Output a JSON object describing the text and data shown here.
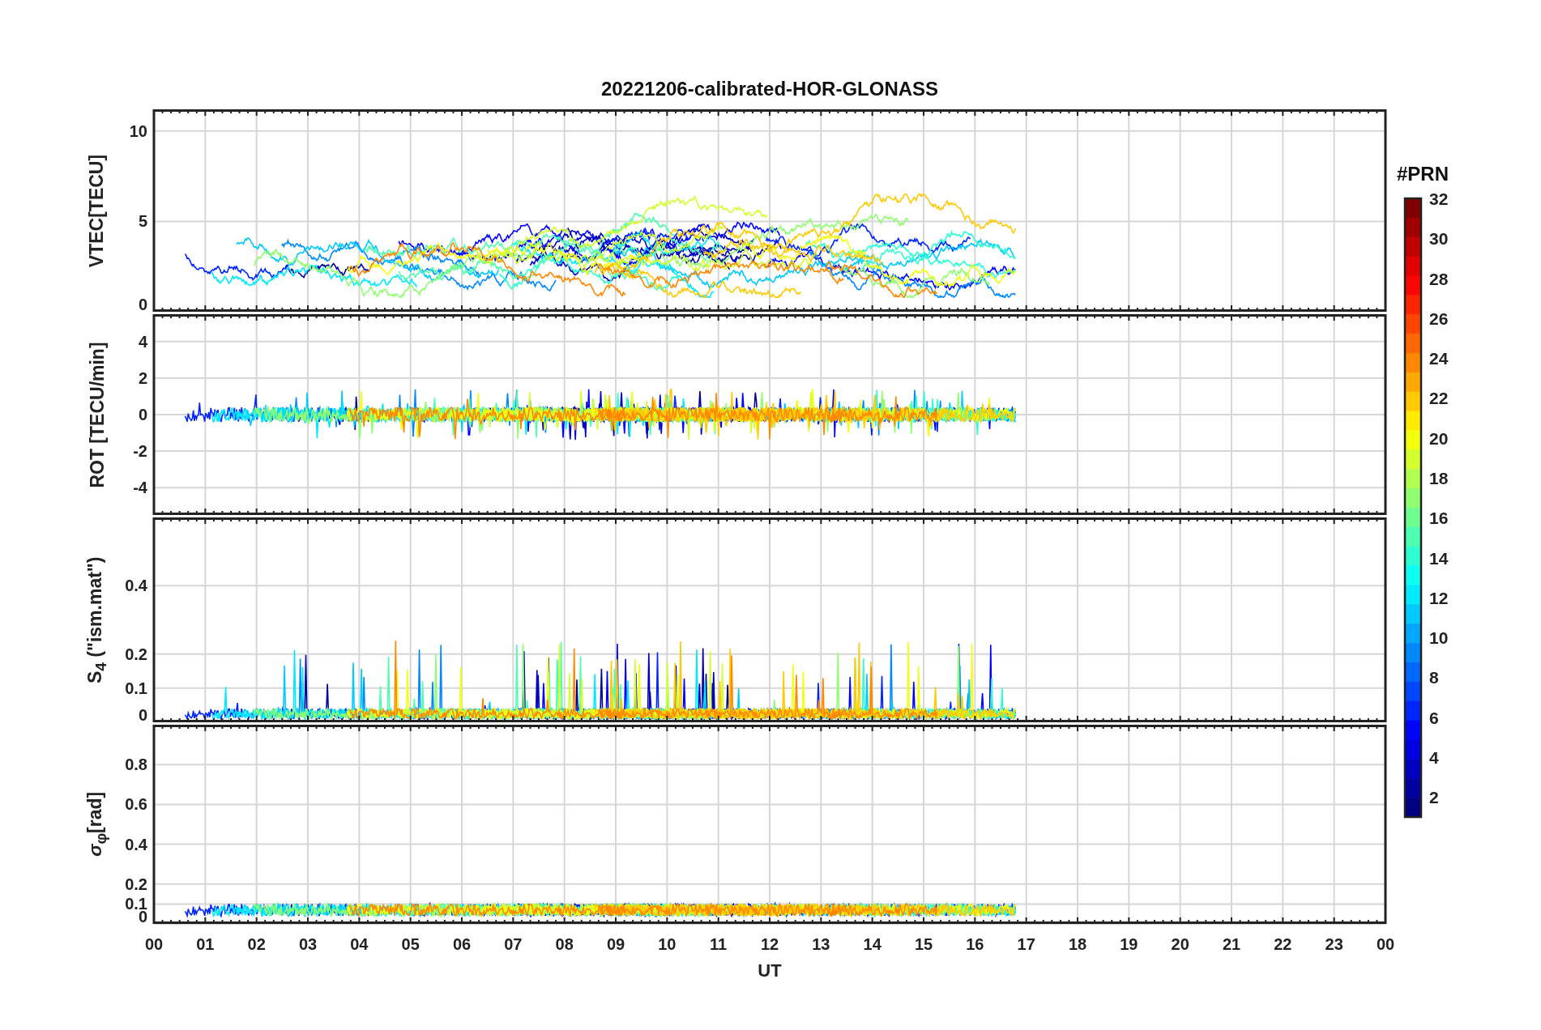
{
  "figure": {
    "title": "20221206-calibrated-HOR-GLONASS",
    "xlabel": "UT",
    "xtick_labels": [
      "00",
      "01",
      "02",
      "03",
      "04",
      "05",
      "06",
      "07",
      "08",
      "09",
      "10",
      "11",
      "12",
      "13",
      "14",
      "15",
      "16",
      "17",
      "18",
      "19",
      "20",
      "21",
      "22",
      "23",
      "00"
    ]
  },
  "panels": [
    {
      "kind": "vtec",
      "ylabel": "VTEC[TECU]",
      "ytick_labels": [
        "10",
        "5",
        "0"
      ]
    },
    {
      "kind": "rot",
      "ylabel": "ROT [TECU/min]",
      "ytick_labels": [
        "4",
        "2",
        "0",
        "-2",
        "-4"
      ]
    },
    {
      "kind": "s4",
      "ylabel": "S$_{4}$ (\"ism.mat\")",
      "ytick_labels": [
        "0.4",
        "0.2",
        "0.1",
        "0"
      ]
    },
    {
      "kind": "sigma",
      "ylabel": "*σ*$_{φ}$[rad]",
      "ytick_labels": [
        "0.8",
        "0.6",
        "0.4",
        "0.2",
        "0.1",
        "0"
      ]
    }
  ],
  "colorbar": {
    "title": "#PRN",
    "tick_labels": [
      "32",
      "30",
      "28",
      "26",
      "24",
      "22",
      "20",
      "18",
      "16",
      "14",
      "12",
      "10",
      "8",
      "6",
      "4",
      "2"
    ]
  }
}
